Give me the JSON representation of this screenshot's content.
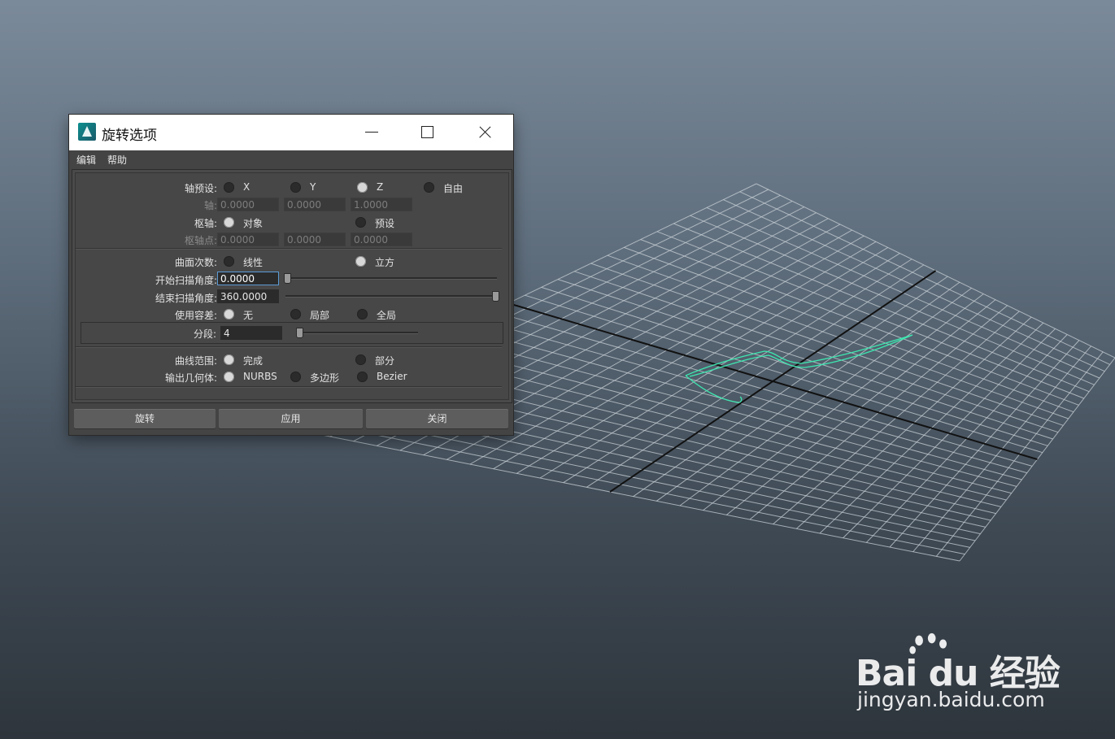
{
  "dialog": {
    "title": "旋转选项",
    "menu": {
      "edit": "编辑",
      "help": "帮助"
    },
    "axis_preset": {
      "label": "轴预设:",
      "options": [
        "X",
        "Y",
        "Z",
        "自由"
      ],
      "selected": "Z"
    },
    "axis": {
      "label": "轴:",
      "values": [
        "0.0000",
        "0.0000",
        "1.0000"
      ]
    },
    "pivot": {
      "label": "枢轴:",
      "options": [
        "对象",
        "预设"
      ],
      "selected": "对象"
    },
    "pivot_point": {
      "label": "枢轴点:",
      "values": [
        "0.0000",
        "0.0000",
        "0.0000"
      ]
    },
    "surface_degree": {
      "label": "曲面次数:",
      "options": [
        "线性",
        "立方"
      ],
      "selected": "立方"
    },
    "start_sweep": {
      "label": "开始扫描角度:",
      "value": "0.0000"
    },
    "end_sweep": {
      "label": "结束扫描角度:",
      "value": "360.0000"
    },
    "tolerance": {
      "label": "使用容差:",
      "options": [
        "无",
        "局部",
        "全局"
      ],
      "selected": "无"
    },
    "segments": {
      "label": "分段:",
      "value": "4"
    },
    "curve_range": {
      "label": "曲线范围:",
      "options": [
        "完成",
        "部分"
      ],
      "selected": "完成"
    },
    "output_geometry": {
      "label": "输出几何体:",
      "options": [
        "NURBS",
        "多边形",
        "Bezier"
      ],
      "selected": "NURBS"
    },
    "buttons": {
      "revolve": "旋转",
      "apply": "应用",
      "close": "关闭"
    }
  },
  "watermark": {
    "logo": "Bai du 经验",
    "url": "jingyan.baidu.com"
  },
  "colors": {
    "curve": "#3ee6b0",
    "dialog_bg": "#444444",
    "focus": "#5b9bd5"
  }
}
